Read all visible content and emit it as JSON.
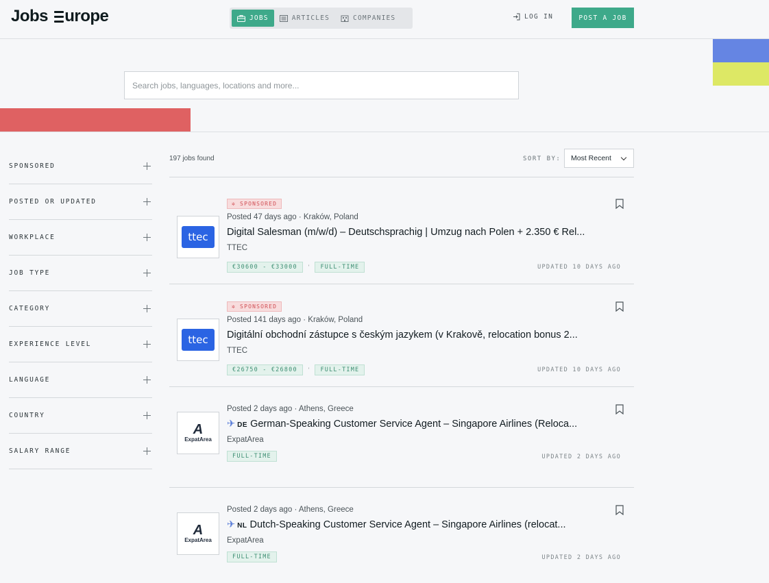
{
  "header": {
    "logo_part1": "Jobs",
    "logo_part2": "urope",
    "tabs": [
      {
        "label": "JOBS",
        "icon": "briefcase-icon",
        "active": true
      },
      {
        "label": "ARTICLES",
        "icon": "newspaper-icon",
        "active": false
      },
      {
        "label": "COMPANIES",
        "icon": "building-icon",
        "active": false
      }
    ],
    "login_label": "LOG IN",
    "post_job_label": "POST A JOB"
  },
  "search": {
    "placeholder": "Search jobs, languages, locations and more..."
  },
  "colors": {
    "accent": "#3ea98a",
    "flag_blue": "#6585e3",
    "flag_yellow": "#dde865",
    "red_bar": "#df6162"
  },
  "filters": [
    {
      "label": "SPONSORED"
    },
    {
      "label": "POSTED OR UPDATED"
    },
    {
      "label": "WORKPLACE"
    },
    {
      "label": "JOB TYPE"
    },
    {
      "label": "CATEGORY"
    },
    {
      "label": "EXPERIENCE LEVEL"
    },
    {
      "label": "LANGUAGE"
    },
    {
      "label": "COUNTRY"
    },
    {
      "label": "SALARY RANGE"
    }
  ],
  "results": {
    "count_text": "197 jobs found",
    "sort_label": "SORT BY:",
    "sort_value": "Most Recent"
  },
  "jobs": [
    {
      "sponsored": "SPONSORED",
      "meta": "Posted 47 days ago · Kraków, Poland",
      "title": "Digital Salesman (m/w/d) – Deutschsprachig | Umzug nach Polen + 2.350 € Rel...",
      "company": "TTEC",
      "logo": "ttec",
      "salary": "€30600 - €33000",
      "job_type": "FULL-TIME",
      "updated": "UPDATED 10 DAYS AGO"
    },
    {
      "sponsored": "SPONSORED",
      "meta": "Posted 141 days ago · Kraków, Poland",
      "title": "Digitální obchodní zástupce s českým jazykem (v Krakově, relocation bonus 2...",
      "company": "TTEC",
      "logo": "ttec",
      "salary": "€26750 - €26800",
      "job_type": "FULL-TIME",
      "updated": "UPDATED 10 DAYS AGO"
    },
    {
      "meta": "Posted 2 days ago · Athens, Greece",
      "country_code": "DE",
      "title": "German-Speaking Customer Service Agent – Singapore Airlines (Reloca...",
      "company": "ExpatArea",
      "logo": "expatarea",
      "job_type": "FULL-TIME",
      "updated": "UPDATED 2 DAYS AGO"
    },
    {
      "meta": "Posted 2 days ago · Athens, Greece",
      "country_code": "NL",
      "title": "Dutch-Speaking Customer Service Agent – Singapore Airlines (relocat...",
      "company": "ExpatArea",
      "logo": "expatarea",
      "job_type": "FULL-TIME",
      "updated": "UPDATED 2 DAYS AGO"
    }
  ],
  "logos": {
    "ttec_text": "ttec",
    "expat_mark": "A",
    "expat_text": "ExpatArea"
  }
}
